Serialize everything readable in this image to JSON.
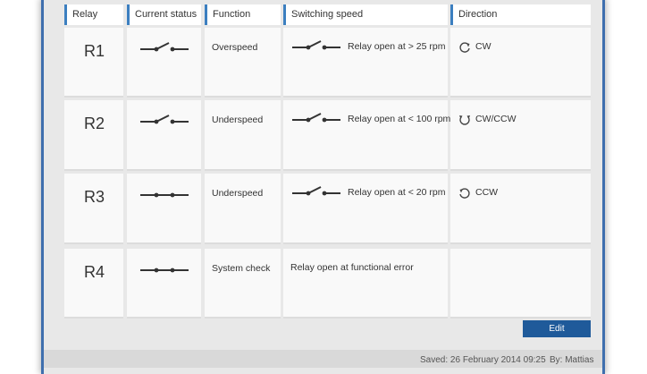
{
  "table": {
    "headers": [
      "Relay",
      "Current status",
      "Function",
      "Switching speed",
      "Direction"
    ],
    "rows": [
      {
        "relay": "R1",
        "status": "open",
        "function": "Overspeed",
        "speed_text": "Relay open at >  25 rpm",
        "speed_switch": "open",
        "direction": "CW",
        "direction_icon": "clockwise-icon"
      },
      {
        "relay": "R2",
        "status": "open",
        "function": "Underspeed",
        "speed_text": "Relay open at <  100 rpm",
        "speed_switch": "open",
        "direction": "CW/CCW",
        "direction_icon": "bidirectional-icon"
      },
      {
        "relay": "R3",
        "status": "closed",
        "function": "Underspeed",
        "speed_text": "Relay open at <  20 rpm",
        "speed_switch": "open",
        "direction": "CCW",
        "direction_icon": "counterclockwise-icon"
      },
      {
        "relay": "R4",
        "status": "closed",
        "function": "System check",
        "speed_text": "Relay open at functional error",
        "speed_switch": "none",
        "direction": "",
        "direction_icon": ""
      }
    ]
  },
  "actions": {
    "edit_label": "Edit"
  },
  "footer": {
    "saved": "Saved: 26 February 2014 09:25",
    "by": "By: Mattias"
  },
  "colors": {
    "accent": "#1f5a9a",
    "header_bar": "#3c7fc0"
  }
}
